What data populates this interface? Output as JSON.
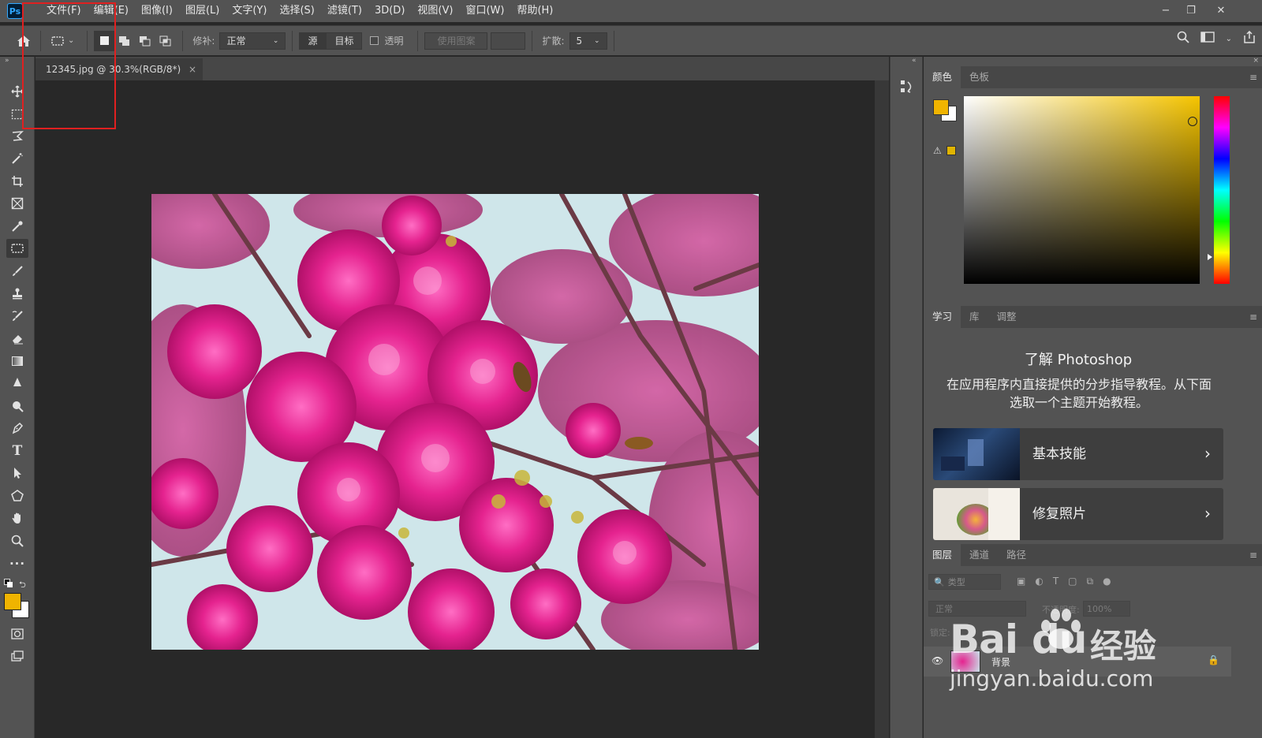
{
  "app": {
    "logo_text": "Ps"
  },
  "menu": [
    "文件(F)",
    "编辑(E)",
    "图像(I)",
    "图层(L)",
    "文字(Y)",
    "选择(S)",
    "滤镜(T)",
    "3D(D)",
    "视图(V)",
    "窗口(W)",
    "帮助(H)"
  ],
  "options_bar": {
    "repair_label": "修补:",
    "repair_mode": "正常",
    "source_label": "源",
    "target_label": "目标",
    "transparent_label": "透明",
    "use_pattern_label": "使用图案",
    "diffusion_label": "扩散:",
    "diffusion_value": "5"
  },
  "document": {
    "tab_title": "12345.jpg @ 30.3%(RGB/8*)",
    "close_symbol": "×"
  },
  "color_panel": {
    "tabs": [
      "颜色",
      "色板"
    ],
    "foreground": "#f0b400"
  },
  "learn_panel": {
    "tabs": [
      "学习",
      "库",
      "调整"
    ],
    "title": "了解 Photoshop",
    "description": "在应用程序内直接提供的分步指导教程。从下面选取一个主题开始教程。",
    "cards": [
      {
        "label": "基本技能"
      },
      {
        "label": "修复照片"
      }
    ]
  },
  "layers_panel": {
    "tabs": [
      "图层",
      "通道",
      "路径"
    ],
    "filter_placeholder": "类型",
    "blend_mode": "正常",
    "opacity_label": "不透明度:",
    "opacity_value": "100%",
    "lock_label": "锁定:",
    "layer_name": "背景"
  },
  "watermark": {
    "brand": "Bai",
    "brand_tail": "du",
    "product": "经验",
    "url": "jingyan.baidu.com"
  },
  "colors": {
    "accent_red": "#e02020",
    "bg_dark": "#282828",
    "panel": "#535353"
  }
}
